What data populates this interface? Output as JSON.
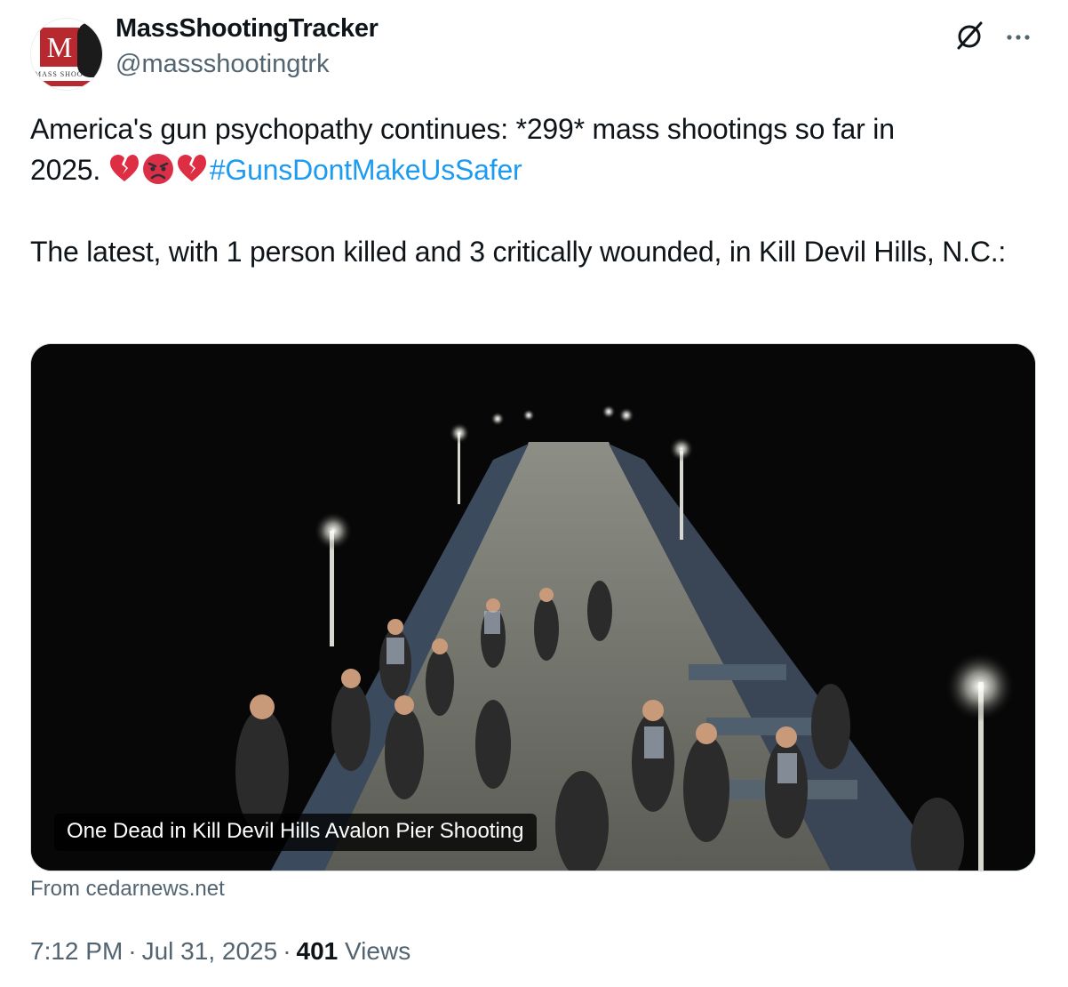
{
  "author": {
    "name": "MassShootingTracker",
    "handle": "@massshootingtrk",
    "avatar_letter": "M",
    "avatar_subtext": "MASS SHOO"
  },
  "tweet": {
    "line1_text": "America's gun psychopathy continues: *299* mass shootings so far in",
    "line2_text": "2025. ",
    "emojis": [
      "broken-heart-emoji",
      "angry-face-emoji",
      "broken-heart-emoji"
    ],
    "hashtag": "#GunsDontMakeUsSafer",
    "paragraph2": "The latest, with 1 person killed and 3 critically wounded, in Kill Devil Hills, N.C.:"
  },
  "media": {
    "caption": "One Dead in Kill Devil Hills Avalon Pier Shooting",
    "source_label": "From cedarnews.net"
  },
  "meta": {
    "time": "7:12 PM",
    "date": "Jul 31, 2025",
    "views_count": "401",
    "views_label": "Views"
  },
  "icons": {
    "grok": "grok-icon",
    "more": "more-icon"
  },
  "colors": {
    "link": "#1d9bf0",
    "secondary_text": "#536471",
    "primary_text": "#0f1419",
    "avatar_red": "#b8292f"
  }
}
